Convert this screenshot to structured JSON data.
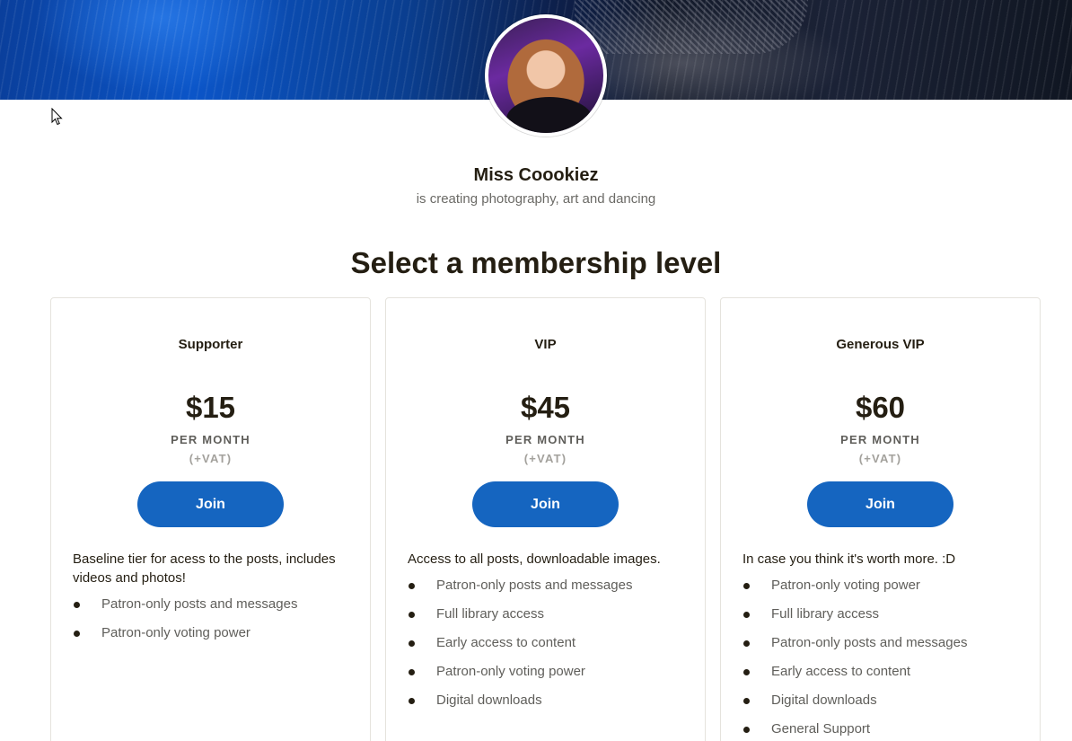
{
  "creator": {
    "name": "Miss Coookiez",
    "description": "is creating photography, art and dancing"
  },
  "page": {
    "section_title": "Select a membership level"
  },
  "colors": {
    "accent": "#1565c0",
    "text": "#241e12",
    "muted": "#5f5e5a"
  },
  "tiers": [
    {
      "name": "Supporter",
      "price": "$15",
      "period": "PER MONTH",
      "vat": "(+VAT)",
      "join_label": "Join",
      "description": "Baseline tier for acess to the posts, includes videos and photos!",
      "benefits": [
        "Patron-only posts and messages",
        "Patron-only voting power"
      ]
    },
    {
      "name": "VIP",
      "price": "$45",
      "period": "PER MONTH",
      "vat": "(+VAT)",
      "join_label": "Join",
      "description": "Access to all posts, downloadable images.",
      "benefits": [
        "Patron-only posts and messages",
        "Full library access",
        "Early access to content",
        "Patron-only voting power",
        "Digital downloads"
      ]
    },
    {
      "name": "Generous VIP",
      "price": "$60",
      "period": "PER MONTH",
      "vat": "(+VAT)",
      "join_label": "Join",
      "description": "In case you think it's worth more. :D",
      "benefits": [
        "Patron-only voting power",
        "Full library access",
        "Patron-only posts and messages",
        "Early access to content",
        "Digital downloads",
        "General Support"
      ]
    }
  ]
}
